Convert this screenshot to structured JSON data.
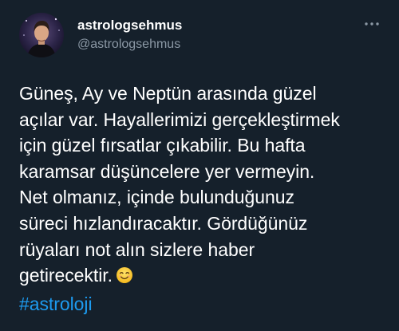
{
  "colors": {
    "background": "#15202b",
    "text": "#ffffff",
    "secondary_text": "#8b98a5",
    "link": "#1d9bf0"
  },
  "author": {
    "display_name": "astrologsehmus",
    "handle": "@astrologsehmus",
    "avatar_icon": "profile-photo"
  },
  "more_menu_icon": "ellipsis-icon",
  "tweet": {
    "lines": [
      "Güneş, Ay ve Neptün arasında güzel",
      "açılar var. Hayallerimizi gerçekleştirmek",
      "için güzel fırsatlar çıkabilir. Bu hafta",
      "karamsar düşüncelere yer vermeyin.",
      "Net olmanız, içinde bulunduğunuz",
      "süreci hızlandıracaktır. Gördüğünüz",
      "rüyaları not alın sizlere haber",
      "getirecektir."
    ],
    "emoji_icon": "smiling-face-emoji",
    "hashtag": "#astroloji"
  }
}
